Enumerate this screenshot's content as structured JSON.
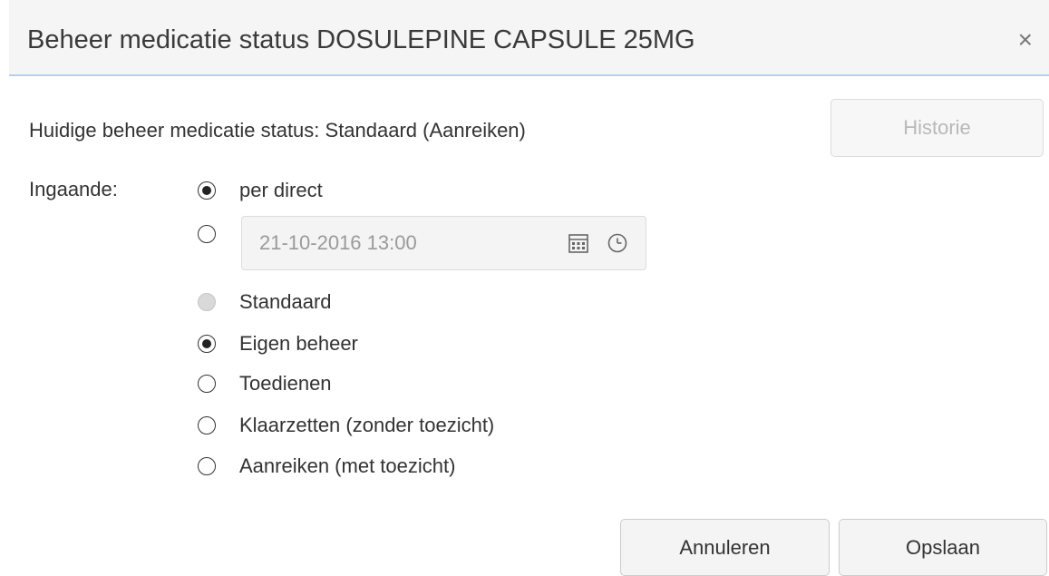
{
  "dialog": {
    "title": "Beheer medicatie status DOSULEPINE CAPSULE 25MG",
    "close_glyph": "×"
  },
  "status": {
    "current_text": "Huidige beheer medicatie status: Standaard (Aanreiken)",
    "history_label": "Historie"
  },
  "effective": {
    "label": "Ingaande:",
    "options": [
      {
        "label": "per direct",
        "selected": true
      },
      {
        "label": "",
        "selected": false
      }
    ],
    "datetime_value": "21-10-2016 13:00",
    "calendar_icon": "calendar-icon",
    "clock_icon": "clock-icon"
  },
  "management": {
    "options": [
      {
        "label": "Standaard",
        "selected": false,
        "disabled": true
      },
      {
        "label": "Eigen beheer",
        "selected": true,
        "disabled": false
      },
      {
        "label": "Toedienen",
        "selected": false,
        "disabled": false
      },
      {
        "label": "Klaarzetten (zonder toezicht)",
        "selected": false,
        "disabled": false
      },
      {
        "label": "Aanreiken (met toezicht)",
        "selected": false,
        "disabled": false
      }
    ]
  },
  "footer": {
    "cancel_label": "Annuleren",
    "save_label": "Opslaan"
  },
  "colors": {
    "header_bg": "#f5f5f5",
    "header_border": "#b8cfe8",
    "disabled_text": "#b8b8b8"
  }
}
